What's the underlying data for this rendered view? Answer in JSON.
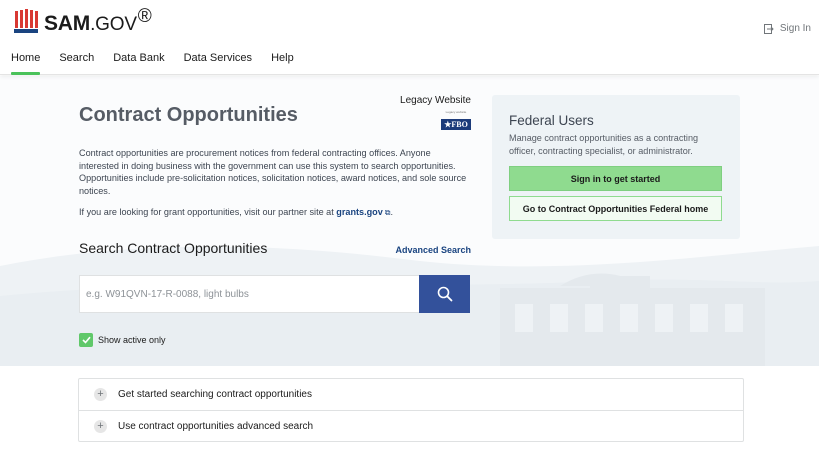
{
  "brand": {
    "name_bold": "SAM",
    "name_light": ".GOV",
    "reg": "®"
  },
  "header": {
    "signin_label": "Sign In"
  },
  "nav": {
    "items": [
      "Home",
      "Search",
      "Data Bank",
      "Data Services",
      "Help"
    ],
    "active": "Home"
  },
  "page": {
    "title": "Contract Opportunities",
    "legacy_label": "Legacy Website",
    "fbo_small": "Legacy website",
    "fbo_badge": "★FBO",
    "description": "Contract opportunities are procurement notices from federal contracting offices. Anyone interested in doing business with the government can use this system to search opportunities. Opportunities include pre-solicitation notices, solicitation notices, award notices, and sole source notices.",
    "grants_prefix": "If you are looking for grant opportunities, visit our partner site at ",
    "grants_link": "grants.gov",
    "grants_suffix": "."
  },
  "search": {
    "title": "Search Contract Opportunities",
    "advanced_label": "Advanced Search",
    "placeholder": "e.g. W91QVN-17-R-0088, light bulbs",
    "show_active_label": "Show active only",
    "show_active_checked": true
  },
  "federal": {
    "title": "Federal Users",
    "description": "Manage contract opportunities as a contracting officer, contracting specialist, or administrator.",
    "signin_button": "Sign in to get started",
    "home_button": "Go to Contract Opportunities Federal home"
  },
  "accordion": {
    "items": [
      "Get started searching contract opportunities",
      "Use contract opportunities advanced search"
    ]
  },
  "colors": {
    "accent_green": "#4ac25a",
    "search_button": "#33519b",
    "link_blue": "#1a4480"
  }
}
